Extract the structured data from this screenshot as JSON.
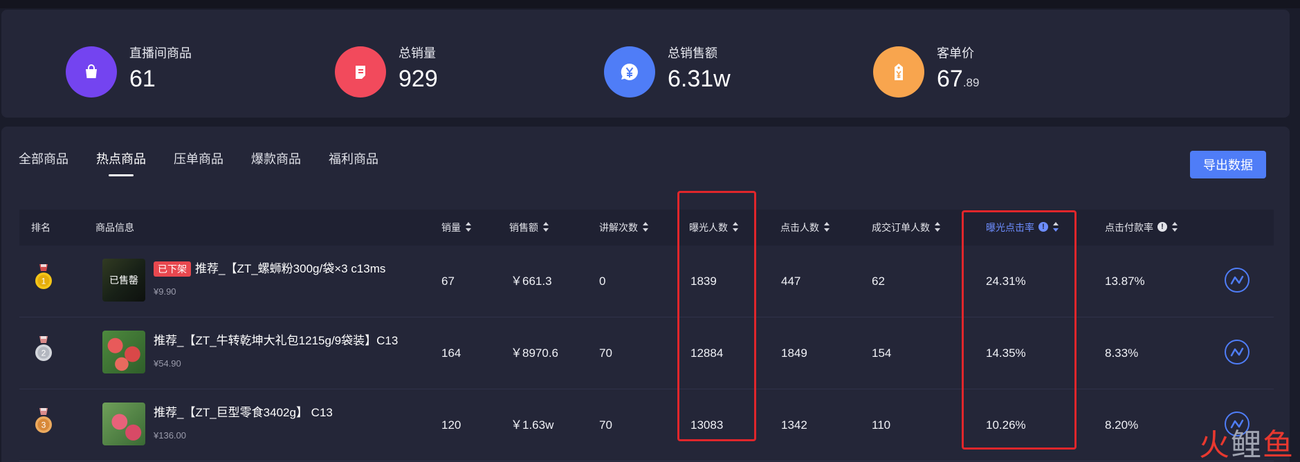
{
  "stats": [
    {
      "label": "直播间商品",
      "value": "61",
      "value_small": "",
      "icon": "shopping-bag-icon",
      "color": "#7444f0"
    },
    {
      "label": "总销量",
      "value": "929",
      "value_small": "",
      "icon": "document-icon",
      "color": "#f24a5c"
    },
    {
      "label": "总销售额",
      "value": "6.31w",
      "value_small": "",
      "icon": "yuan-chat-icon",
      "color": "#4f7df7"
    },
    {
      "label": "客单价",
      "value": "67",
      "value_small": ".89",
      "icon": "price-tag-icon",
      "color": "#f8a54e"
    }
  ],
  "tabs": [
    "全部商品",
    "热点商品",
    "压单商品",
    "爆款商品",
    "福利商品"
  ],
  "active_tab": "热点商品",
  "export_label": "导出数据",
  "columns": {
    "rank": "排名",
    "product": "商品信息",
    "sales": "销量",
    "revenue": "销售额",
    "explains": "讲解次数",
    "exposure": "曝光人数",
    "clicks": "点击人数",
    "orders": "成交订单人数",
    "ctr": "曝光点击率",
    "cvr": "点击付款率"
  },
  "rows": [
    {
      "rank": "1",
      "medal_color": "#f5c518",
      "tag": "已下架",
      "overlay": "已售罄",
      "name": "推荐_【ZT_螺蛳粉300g/袋×3 c13ms",
      "price": "¥9.90",
      "sales": "67",
      "revenue": "￥661.3",
      "explains": "0",
      "exposure": "1839",
      "clicks": "447",
      "orders": "62",
      "ctr": "24.31%",
      "cvr": "13.87%"
    },
    {
      "rank": "2",
      "medal_color": "#bfc3cc",
      "tag": "",
      "overlay": "",
      "name": "推荐_【ZT_牛转乾坤大礼包1215g/9袋装】C13",
      "price": "¥54.90",
      "sales": "164",
      "revenue": "￥8970.6",
      "explains": "70",
      "exposure": "12884",
      "clicks": "1849",
      "orders": "154",
      "ctr": "14.35%",
      "cvr": "8.33%"
    },
    {
      "rank": "3",
      "medal_color": "#e79a4a",
      "tag": "",
      "overlay": "",
      "name": "推荐_【ZT_巨型零食3402g】 C13",
      "price": "¥136.00",
      "sales": "120",
      "revenue": "￥1.63w",
      "explains": "70",
      "exposure": "13083",
      "clicks": "1342",
      "orders": "110",
      "ctr": "10.26%",
      "cvr": "8.20%"
    }
  ],
  "watermark": {
    "chars": [
      "火",
      "鲤",
      "鱼"
    ],
    "colors": [
      "#e8382f",
      "#9fa3b0",
      "#e8382f"
    ]
  },
  "highlight_color": "#e0262b",
  "accent": "#4f7df7"
}
